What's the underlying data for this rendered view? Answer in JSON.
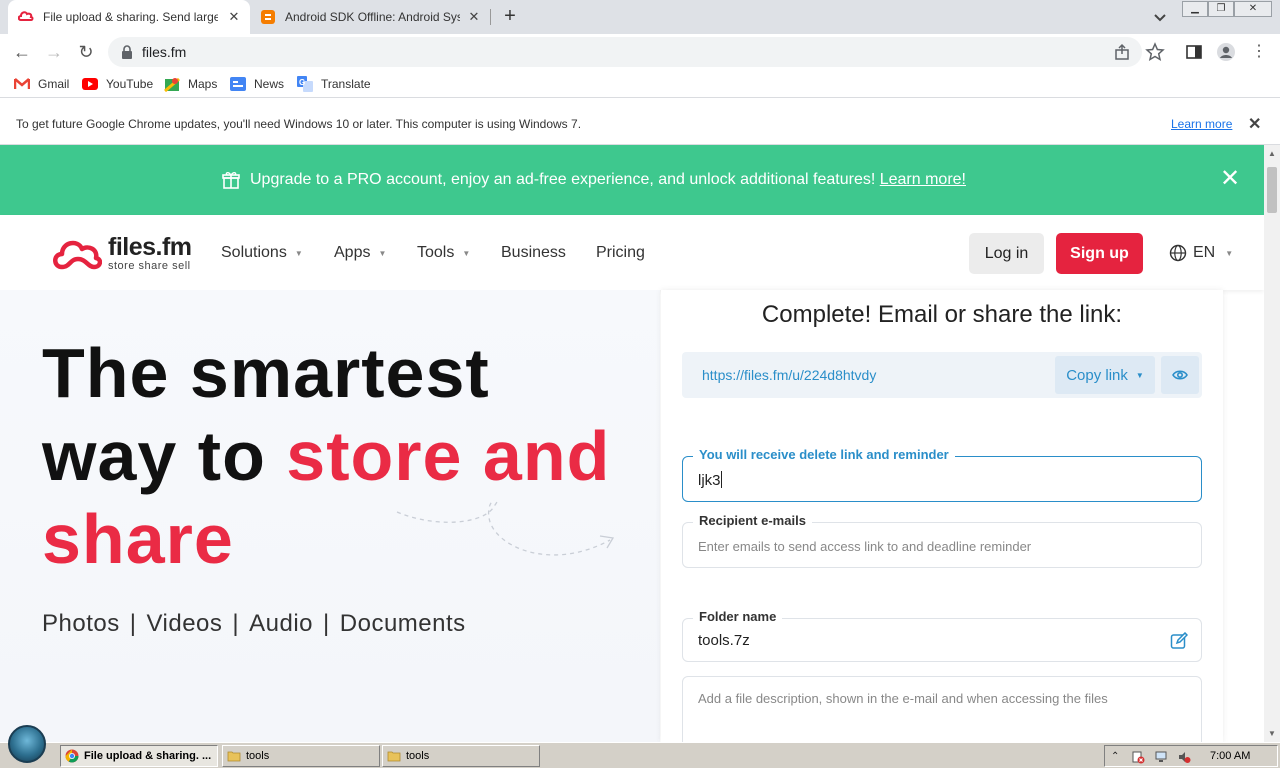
{
  "browser": {
    "tabs": [
      {
        "title": "File upload & sharing. Send large ph",
        "active": true
      },
      {
        "title": "Android SDK Offline: Android Syster",
        "active": false
      }
    ],
    "url": "files.fm",
    "bookmarks": [
      "Gmail",
      "YouTube",
      "Maps",
      "News",
      "Translate"
    ],
    "infobar": {
      "message": "To get future Google Chrome updates, you'll need Windows 10 or later. This computer is using Windows 7.",
      "link": "Learn more"
    }
  },
  "promo": {
    "text": "Upgrade to a PRO account, enjoy an ad-free experience, and unlock additional features!",
    "link": "Learn more!"
  },
  "site": {
    "logo_name": "files.fm",
    "logo_tagline": "store  share  sell",
    "nav": [
      "Solutions",
      "Apps",
      "Tools",
      "Business",
      "Pricing"
    ],
    "login": "Log in",
    "signup": "Sign up",
    "language": "EN"
  },
  "hero": {
    "line1": "The smartest",
    "line2a": "way to ",
    "line2b": "store and",
    "line3": "share",
    "types": [
      "Photos",
      "Videos",
      "Audio",
      "Documents"
    ],
    "separator": "|"
  },
  "upload": {
    "title": "Complete! Email or share the link:",
    "link": "https://files.fm/u/224d8htvdy",
    "copy_label": "Copy link",
    "sender_label": "You will receive delete link and reminder",
    "sender_value": "ljk3",
    "recipient_label": "Recipient e-mails",
    "recipient_placeholder": "Enter emails to send access link to and deadline reminder",
    "folder_label": "Folder name",
    "folder_value": "tools.7z",
    "description_placeholder": "Add a file description, shown in the e-mail and when accessing the files"
  },
  "taskbar": {
    "items": [
      "File upload & sharing. ...",
      "tools",
      "tools"
    ],
    "clock": "7:00 AM"
  },
  "colors": {
    "accent_red": "#ea2b45",
    "promo_green": "#3ec88e",
    "link_blue": "#2a8ec9"
  }
}
